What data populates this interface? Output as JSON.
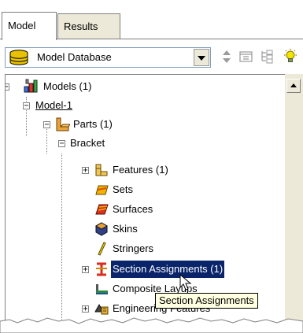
{
  "tabs": [
    {
      "label": "Model",
      "active": true
    },
    {
      "label": "Results",
      "active": false
    }
  ],
  "toolbar": {
    "database_select": {
      "value": "Model Database"
    }
  },
  "tree": {
    "items": [
      {
        "label": "Models (1)"
      },
      {
        "label": "Model-1"
      },
      {
        "label": "Parts (1)"
      },
      {
        "label": "Bracket"
      },
      {
        "label": "Features (1)"
      },
      {
        "label": "Sets"
      },
      {
        "label": "Surfaces"
      },
      {
        "label": "Skins"
      },
      {
        "label": "Stringers"
      },
      {
        "label": "Section Assignments (1)",
        "selected": true
      },
      {
        "label": "Composite Layups"
      },
      {
        "label": "Engineering Features"
      }
    ]
  },
  "tooltip": {
    "text": "Section Assignments"
  },
  "colors": {
    "selection": "#0a246a",
    "tooltip_bg": "#ffffe1",
    "panel_bg": "#ece9d8"
  }
}
